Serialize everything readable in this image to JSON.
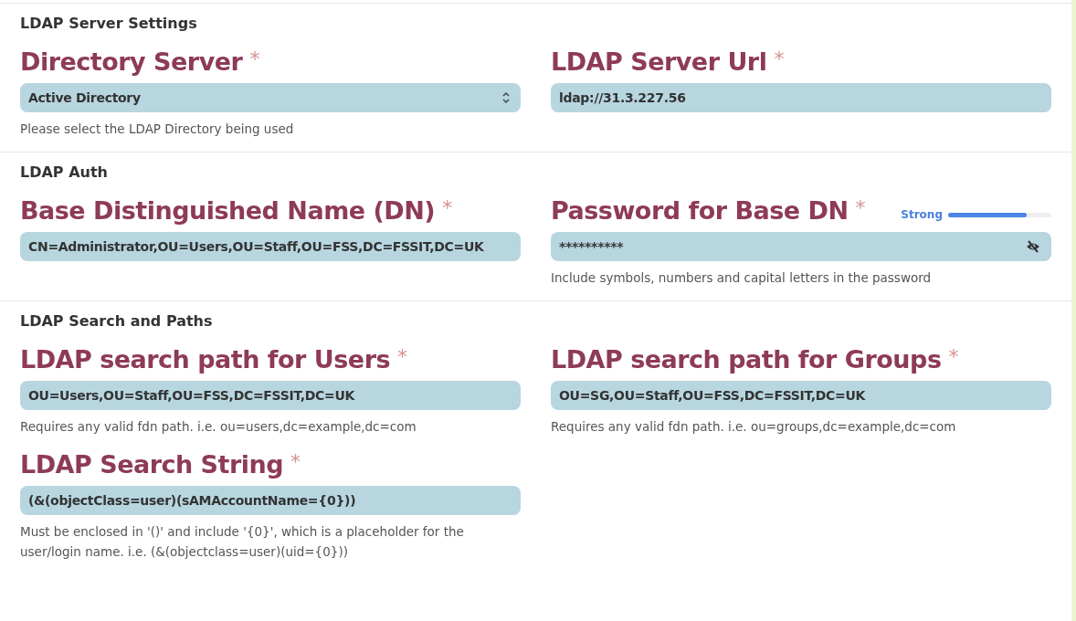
{
  "sections": [
    {
      "title": "LDAP Server Settings",
      "fields": [
        {
          "kind": "select",
          "label": "Directory Server",
          "required_mark": "*",
          "value": "Active Directory",
          "help": "Please select the LDAP Directory being used"
        },
        {
          "kind": "text",
          "label": "LDAP Server Url",
          "required_mark": "*",
          "value": "ldap://31.3.227.56"
        }
      ]
    },
    {
      "title": "LDAP Auth",
      "fields": [
        {
          "kind": "text",
          "label": "Base Distinguished Name (DN)",
          "required_mark": "*",
          "value": "CN=Administrator,OU=Users,OU=Staff,OU=FSS,DC=FSSIT,DC=UK"
        },
        {
          "kind": "password",
          "label": "Password for Base DN",
          "required_mark": "*",
          "value": "**********",
          "strength": {
            "label": "Strong",
            "level": 0.76
          },
          "help": "Include symbols, numbers and capital letters in the password"
        }
      ]
    },
    {
      "title": "LDAP Search and Paths",
      "fields": [
        {
          "kind": "text",
          "label": "LDAP search path for Users",
          "required_mark": "*",
          "value": "OU=Users,OU=Staff,OU=FSS,DC=FSSIT,DC=UK",
          "help": "Requires any valid fdn path. i.e. ou=users,dc=example,dc=com"
        },
        {
          "kind": "text",
          "label": "LDAP search path for Groups",
          "required_mark": "*",
          "value": "OU=SG,OU=Staff,OU=FSS,DC=FSSIT,DC=UK",
          "help": "Requires any valid fdn path. i.e. ou=groups,dc=example,dc=com"
        },
        {
          "kind": "text",
          "label": "LDAP Search String",
          "required_mark": "*",
          "value": "(&(objectClass=user)(sAMAccountName={0}))",
          "help": "Must be enclosed in '()' and include '{0}', which is a placeholder for the user/login name. i.e. (&(objectclass=user)(uid={0}))"
        }
      ]
    }
  ]
}
